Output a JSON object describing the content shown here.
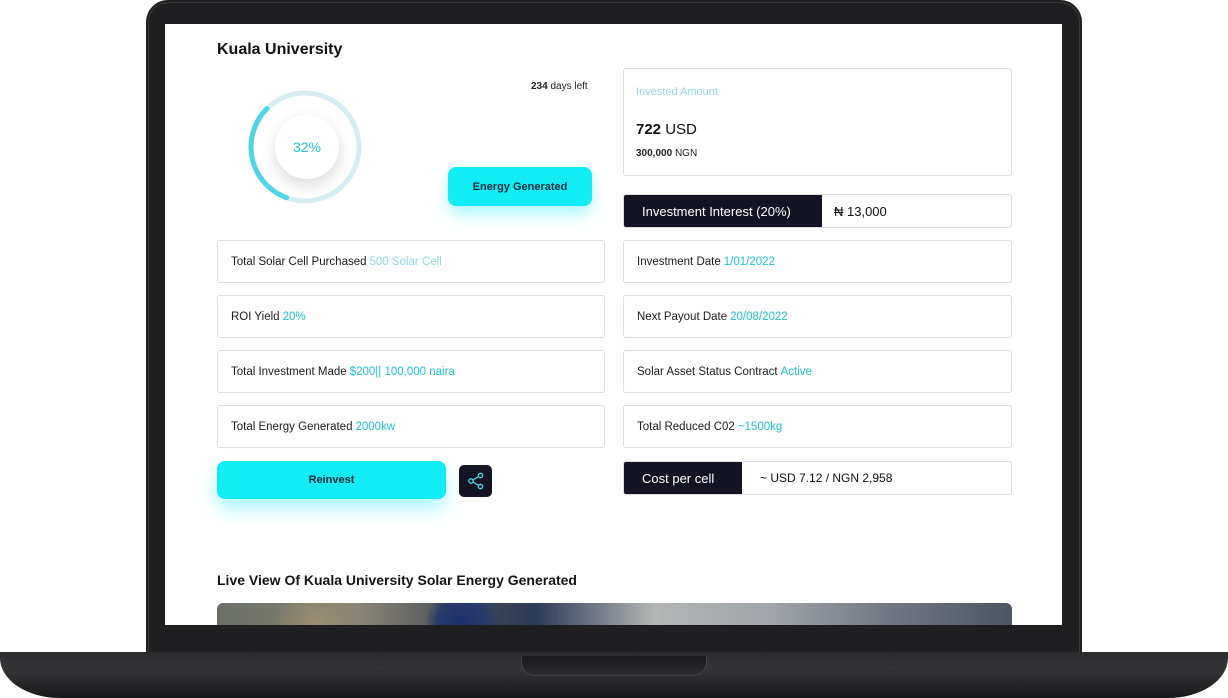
{
  "project": {
    "title": "Kuala University",
    "days_left_number": "234",
    "days_left_text": "days left",
    "progress_label": "32%",
    "progress_fraction": 0.32
  },
  "buttons": {
    "energy_generated": "Energy Generated",
    "reinvest": "Reinvest"
  },
  "invested": {
    "label": "Invested Amount",
    "usd_value": "722",
    "usd_unit": "USD",
    "ngn_value": "300,000",
    "ngn_unit": "NGN"
  },
  "interest": {
    "label": "Investment Interest (20%)",
    "value": "₦ 13,000"
  },
  "left_rows": [
    {
      "label": "Total Solar Cell Purchased",
      "value": "500 Solar Cell"
    },
    {
      "label": "ROI Yield",
      "value": "20%"
    },
    {
      "label": "Total Investment Made",
      "value": "$200|| 100,000 naira"
    },
    {
      "label": "Total Energy Generated",
      "value": "2000kw"
    }
  ],
  "right_rows": [
    {
      "label": "Investment Date",
      "value": "1/01/2022"
    },
    {
      "label": "Next Payout Date",
      "value": "20/08/2022"
    },
    {
      "label": "Solar Asset Status Contract",
      "value": "Active"
    },
    {
      "label": "Total Reduced C02",
      "value": "~1500kg"
    }
  ],
  "cost": {
    "label": "Cost per cell",
    "value": "~ USD 7.12 / NGN 2,958"
  },
  "live": {
    "title": "Live View Of Kuala University Solar Energy Generated"
  },
  "icons": {
    "share": "share-icon"
  },
  "colors": {
    "accent": "#12ecf5",
    "accent_text": "#1fbfd6",
    "dark": "#141425"
  }
}
